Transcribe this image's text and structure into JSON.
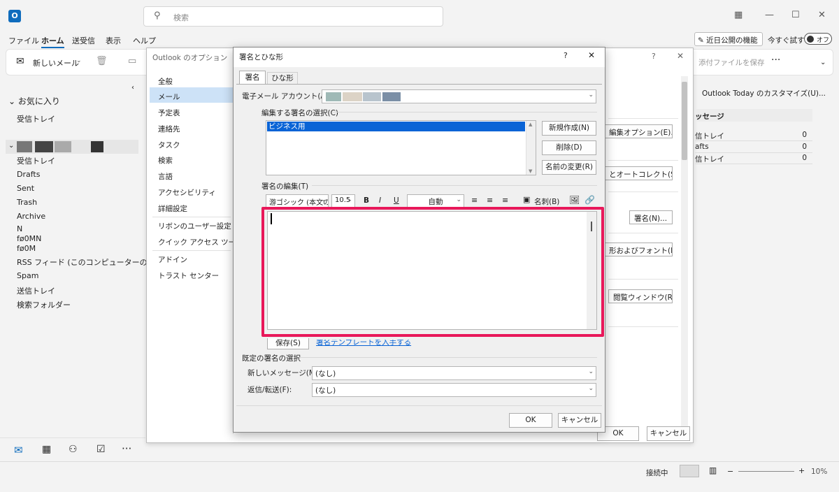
{
  "window": {
    "search_placeholder": "検索",
    "menu": [
      "ファイル",
      "ホーム",
      "送受信",
      "表示",
      "ヘルプ"
    ],
    "new_features": "近日公開の機能",
    "try_now": "今すぐ試す",
    "toggle": "オフ"
  },
  "ribbon": {
    "new_mail": "新しいメール",
    "save_attachment": "添付ファイルを保存"
  },
  "folders": {
    "favorites": "お気に入り",
    "favorites_inbox": "受信トレイ",
    "items": [
      "受信トレイ",
      "Drafts",
      "Sent",
      "Trash",
      "Archive",
      "N",
      "fø0MN",
      "fø0M",
      "RSS フィード (このコンピューターのみ)",
      "Spam",
      "送信トレイ",
      "検索フォルダー"
    ]
  },
  "status": {
    "connection": "接続中",
    "zoom": "10%"
  },
  "options": {
    "title": "Outlook のオプション",
    "nav": [
      "全般",
      "メール",
      "予定表",
      "連絡先",
      "タスク",
      "検索",
      "言語",
      "アクセシビリティ",
      "詳細設定",
      "リボンのユーザー設定",
      "クイック アクセス ツール バー",
      "アドイン",
      "トラスト センター"
    ],
    "right_buttons": [
      "編集オプション(E)...",
      "とオートコレクト(S)...",
      "署名(N)...",
      "形およびフォント(F)...",
      "閲覧ウィンドウ(R)..."
    ],
    "ok": "OK",
    "cancel": "キャンセル"
  },
  "today": {
    "button": "Outlook Today のカスタマイズ(U)...",
    "header": "ッセージ",
    "rows": [
      {
        "name": "信トレイ",
        "count": "0"
      },
      {
        "name": "afts",
        "count": "0"
      },
      {
        "name": "信トレイ",
        "count": "0"
      }
    ]
  },
  "signature_dialog": {
    "title": "署名とひな形",
    "help": "?",
    "tabs": [
      "署名",
      "ひな形"
    ],
    "account_label": "電子メール アカウント(A):",
    "select_label": "編集する署名の選択(C)",
    "signatures": [
      "ビジネス用"
    ],
    "btn_new": "新規作成(N)",
    "btn_delete": "削除(D)",
    "btn_rename": "名前の変更(R)",
    "edit_label": "署名の編集(T)",
    "font": "游ゴシック (本文の",
    "size": "10.5",
    "bold": "B",
    "italic": "I",
    "underline": "U",
    "color": "自動",
    "business_card": "名刺(B)",
    "save": "保存(S)",
    "template_link": "署名テンプレートを入手する",
    "default_label": "既定の署名の選択",
    "new_msg_label": "新しいメッセージ(M):",
    "new_msg_value": "(なし)",
    "reply_label": "返信/転送(F):",
    "reply_value": "(なし)",
    "ok": "OK",
    "cancel": "キャンセル"
  },
  "colors": {
    "highlight": "#e8185a",
    "accent": "#0f6cbd",
    "selection": "#0a64d6"
  }
}
